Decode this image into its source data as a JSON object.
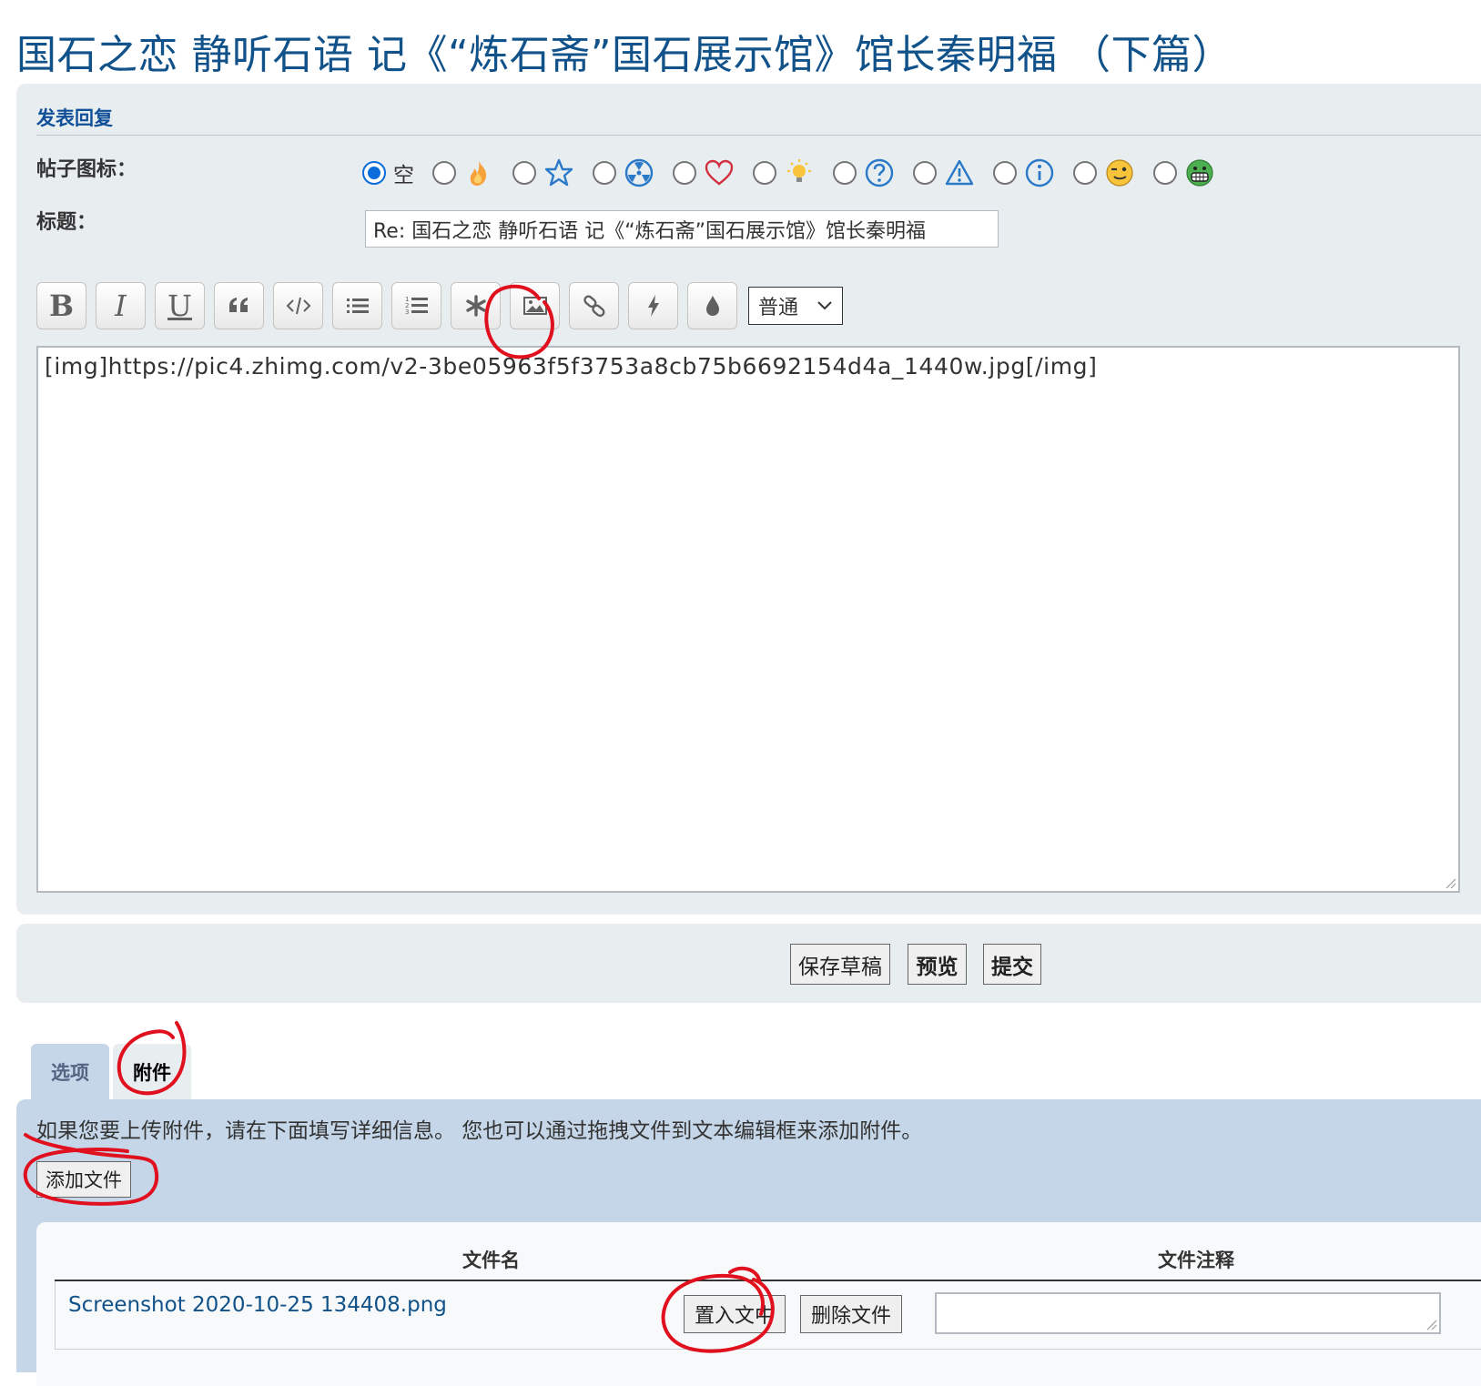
{
  "page": {
    "title": "国石之恋 静听石语 记《“炼石斋”国石展示馆》馆长秦明福 （下篇）"
  },
  "post_form": {
    "heading": "发表回复",
    "icon_label": "帖子图标：",
    "icon_options": [
      {
        "name": "none",
        "label": "空",
        "checked": true
      },
      {
        "name": "fire-icon"
      },
      {
        "name": "star-icon"
      },
      {
        "name": "radioactive-icon"
      },
      {
        "name": "heart-icon"
      },
      {
        "name": "lightbulb-icon"
      },
      {
        "name": "question-icon"
      },
      {
        "name": "warning-icon"
      },
      {
        "name": "info-icon"
      },
      {
        "name": "smiley-wink-icon"
      },
      {
        "name": "smiley-grin-icon"
      }
    ],
    "subject_label": "标题：",
    "subject_value": "Re: 国石之恋 静听石语  记《“炼石斋”国石展示馆》馆长秦明福",
    "toolbar": {
      "bold": "B",
      "italic": "I",
      "underline": "U",
      "font_size_selected": "普通"
    },
    "message": "[img]https://pic4.zhimg.com/v2-3be05963f5f3753a8cb75b6692154d4a_1440w.jpg[/img]"
  },
  "actions": {
    "save_draft": "保存草稿",
    "preview": "预览",
    "submit": "提交"
  },
  "tabs": {
    "options": "选项",
    "attachments": "附件"
  },
  "attachments": {
    "info": "如果您要上传附件，请在下面填写详细信息。 您也可以通过拖拽文件到文本编辑框来添加附件。",
    "add_file": "添加文件",
    "col_filename": "文件名",
    "col_comment": "文件注释",
    "files": [
      {
        "filename": "Screenshot 2020-10-25 134408.png",
        "place_inline": "置入文中",
        "delete": "删除文件"
      }
    ]
  },
  "colors": {
    "title_blue": "#105289",
    "panel_bg": "#e8edf0",
    "attach_bg": "#c5d6e8",
    "annotation_red": "#e0101e"
  }
}
